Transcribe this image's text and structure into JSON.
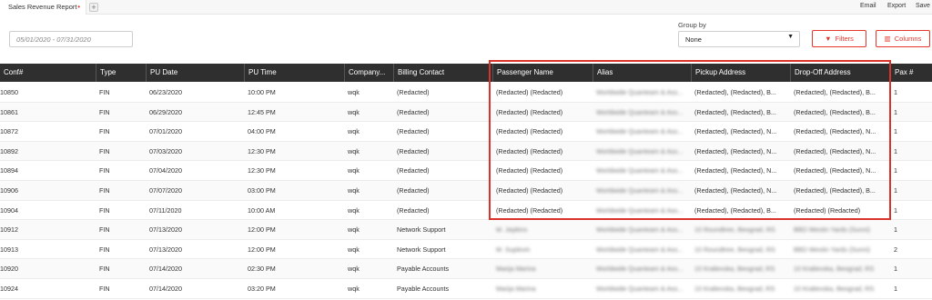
{
  "tabbar": {
    "tab_title": "Sales Revenue Report",
    "modified_marker": "•",
    "add_tab": "+",
    "email_label": "Email",
    "export_label": "Export",
    "save_label": "Save"
  },
  "toolbar": {
    "date_range_placeholder": "05/01/2020 - 07/31/2020",
    "group_by_label": "Group by",
    "group_by_value": "None",
    "filters_label": "Filters",
    "columns_label": "Columns"
  },
  "table": {
    "headers": [
      "Conf#",
      "Type",
      "PU Date",
      "PU Time",
      "Company...",
      "Billing Contact",
      "Passenger Name",
      "Alias",
      "Pickup Address",
      "Drop-Off Address",
      "Pax #"
    ],
    "rows": [
      [
        "10850",
        "FIN",
        "06/23/2020",
        "10:00 PM",
        "wqk",
        "(Redacted)",
        "(Redacted) (Redacted)",
        "Worldwide Quanteam & Ass...",
        "(Redacted), (Redacted), B...",
        "(Redacted), (Redacted), B...",
        "1"
      ],
      [
        "10861",
        "FIN",
        "06/29/2020",
        "12:45 PM",
        "wqk",
        "(Redacted)",
        "(Redacted) (Redacted)",
        "Worldwide Quanteam & Ass...",
        "(Redacted), (Redacted), B...",
        "(Redacted), (Redacted), B...",
        "1"
      ],
      [
        "10872",
        "FIN",
        "07/01/2020",
        "04:00 PM",
        "wqk",
        "(Redacted)",
        "(Redacted) (Redacted)",
        "Worldwide Quanteam & Ass...",
        "(Redacted), (Redacted), N...",
        "(Redacted), (Redacted), N...",
        "1"
      ],
      [
        "10892",
        "FIN",
        "07/03/2020",
        "12:30 PM",
        "wqk",
        "(Redacted)",
        "(Redacted) (Redacted)",
        "Worldwide Quanteam & Ass...",
        "(Redacted), (Redacted), N...",
        "(Redacted), (Redacted), N...",
        "1"
      ],
      [
        "10894",
        "FIN",
        "07/04/2020",
        "12:30 PM",
        "wqk",
        "(Redacted)",
        "(Redacted) (Redacted)",
        "Worldwide Quanteam & Ass...",
        "(Redacted), (Redacted), N...",
        "(Redacted), (Redacted), N...",
        "1"
      ],
      [
        "10906",
        "FIN",
        "07/07/2020",
        "03:00 PM",
        "wqk",
        "(Redacted)",
        "(Redacted) (Redacted)",
        "Worldwide Quanteam & Ass...",
        "(Redacted), (Redacted), N...",
        "(Redacted), (Redacted), B...",
        "1"
      ],
      [
        "10904",
        "FIN",
        "07/11/2020",
        "10:00 AM",
        "wqk",
        "(Redacted)",
        "(Redacted) (Redacted)",
        "Worldwide Quanteam & Ass...",
        "(Redacted), (Redacted), B...",
        "(Redacted) (Redacted)",
        "1"
      ],
      [
        "10912",
        "FIN",
        "07/13/2020",
        "12:00 PM",
        "wqk",
        "Network Support",
        "M. Jepkins",
        "Worldwide Quanteam & Ass...",
        "10 Roundtree, Beograd, RS",
        "BBD Westin Yards (Sunni)",
        "1"
      ],
      [
        "10913",
        "FIN",
        "07/13/2020",
        "12:00 PM",
        "wqk",
        "Network Support",
        "M. Suplevin",
        "Worldwide Quanteam & Ass...",
        "10 Roundtree, Beograd, RS",
        "BBD Westin Yards (Sunni)",
        "2"
      ],
      [
        "10920",
        "FIN",
        "07/14/2020",
        "02:30 PM",
        "wqk",
        "Payable Accounts",
        "Marija Marina",
        "Worldwide Quanteam & Ass...",
        "10 Kralievska, Beograd, RS",
        "10 Kralievska, Beograd, RS",
        "1"
      ],
      [
        "10924",
        "FIN",
        "07/14/2020",
        "03:20 PM",
        "wqk",
        "Payable Accounts",
        "Marija Marina",
        "Worldwide Quanteam & Ass...",
        "10 Kralievska, Beograd, RS",
        "10 Kralievska, Beograd, RS",
        "1"
      ]
    ]
  },
  "colors": {
    "accent": "#e2372b",
    "header_bg": "#2f2f2f"
  },
  "icons": {
    "filters": "filter-icon",
    "columns": "columns-icon",
    "dropdown": "chevron-down-icon"
  }
}
